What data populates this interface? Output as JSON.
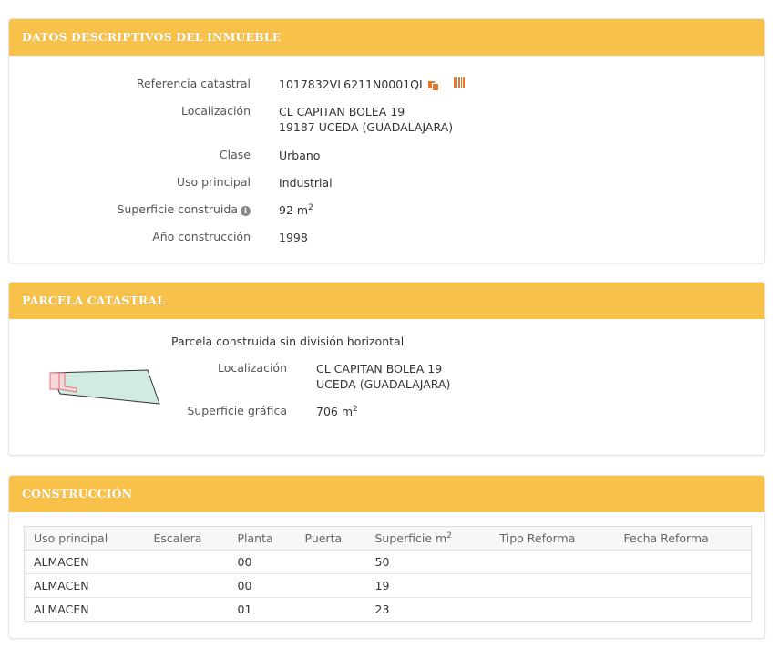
{
  "datos": {
    "header": "DATOS DESCRIPTIVOS DEL INMUEBLE",
    "referencia": {
      "label": "Referencia catastral",
      "value": "1017832VL6211N0001QL"
    },
    "localizacion": {
      "label": "Localización",
      "line1": "CL CAPITAN BOLEA 19",
      "line2": "19187 UCEDA (GUADALAJARA)"
    },
    "clase": {
      "label": "Clase",
      "value": "Urbano"
    },
    "uso": {
      "label": "Uso principal",
      "value": "Industrial"
    },
    "superficie": {
      "label": "Superficie construida",
      "value": "92 m",
      "unit_sup": "2"
    },
    "anio": {
      "label": "Año construcción",
      "value": "1998"
    },
    "icons": {
      "copy": "copy-icon",
      "barcode": "barcode-icon",
      "info": "info-icon"
    },
    "copy_color": "#e8772e"
  },
  "parcela": {
    "header": "PARCELA CATASTRAL",
    "tipo": "Parcela construida sin división horizontal",
    "localizacion": {
      "label": "Localización",
      "line1": "CL CAPITAN BOLEA 19",
      "line2": "UCEDA (GUADALAJARA)"
    },
    "superficie": {
      "label": "Superficie gráfica",
      "value": "706 m",
      "unit_sup": "2"
    },
    "map_fill": "#d2ebe0",
    "map_building_color": "#e0707a"
  },
  "construccion": {
    "header": "CONSTRUCCIÓN",
    "columns": [
      "Uso principal",
      "Escalera",
      "Planta",
      "Puerta",
      "Superficie m",
      "Tipo Reforma",
      "Fecha Reforma"
    ],
    "superficie_col_sup": "2",
    "rows": [
      [
        "ALMACEN",
        "",
        "00",
        "",
        "50",
        "",
        ""
      ],
      [
        "ALMACEN",
        "",
        "00",
        "",
        "19",
        "",
        ""
      ],
      [
        "ALMACEN",
        "",
        "01",
        "",
        "23",
        "",
        ""
      ]
    ]
  },
  "colors": {
    "header_bg": "#f8c24a",
    "header_text": "#ffffff"
  }
}
